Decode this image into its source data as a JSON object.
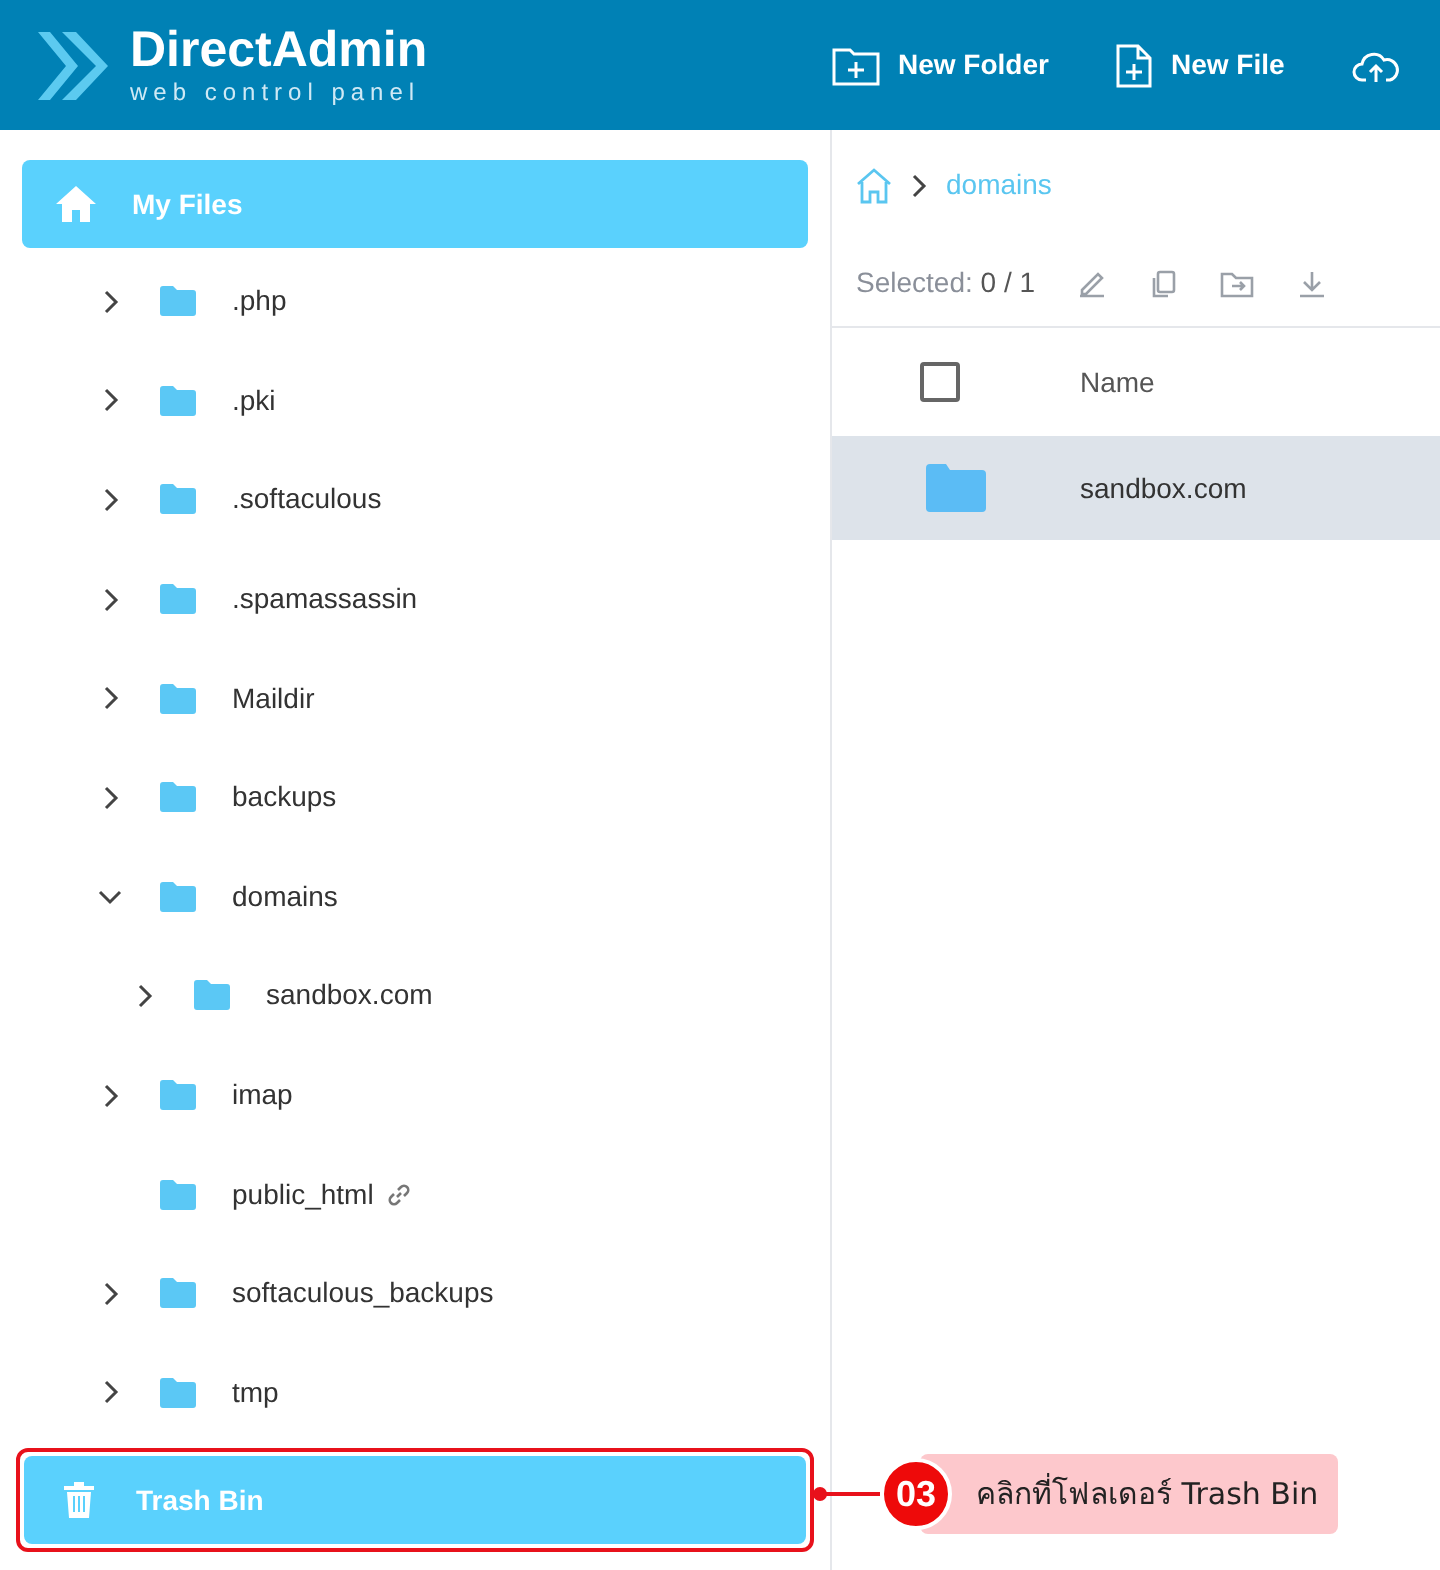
{
  "header": {
    "logo_title": "DirectAdmin",
    "logo_subtitle": "web control panel",
    "actions": [
      {
        "kind": "folder",
        "label": "New Folder"
      },
      {
        "kind": "file",
        "label": "New File"
      },
      {
        "kind": "upload"
      }
    ]
  },
  "sidebar": {
    "home": {
      "label": "My Files",
      "selected": true
    },
    "tree": [
      {
        "name": ".php",
        "expandable": true,
        "expanded": false,
        "linked": false
      },
      {
        "name": ".pki",
        "expandable": true,
        "expanded": false,
        "linked": false
      },
      {
        "name": ".softaculous",
        "expandable": true,
        "expanded": false,
        "linked": false
      },
      {
        "name": ".spamassassin",
        "expandable": true,
        "expanded": false,
        "linked": false
      },
      {
        "name": "Maildir",
        "expandable": true,
        "expanded": false,
        "linked": false
      },
      {
        "name": "backups",
        "expandable": true,
        "expanded": false,
        "linked": false
      },
      {
        "name": "domains",
        "expandable": true,
        "expanded": true,
        "linked": false,
        "children": [
          {
            "name": "sandbox.com",
            "expandable": true,
            "expanded": false
          }
        ]
      },
      {
        "name": "imap",
        "expandable": true,
        "expanded": false,
        "linked": false
      },
      {
        "name": "public_html",
        "expandable": false,
        "expanded": false,
        "linked": true
      },
      {
        "name": "softaculous_backups",
        "expandable": true,
        "expanded": false,
        "linked": false
      },
      {
        "name": "tmp",
        "expandable": true,
        "expanded": false,
        "linked": false
      }
    ],
    "trash": {
      "label": "Trash Bin",
      "selected": true,
      "highlighted": true
    }
  },
  "breadcrumb": [
    "domains"
  ],
  "selection": {
    "label": "Selected:",
    "count": "0 / 1"
  },
  "table": {
    "columns": [
      "Name"
    ],
    "all_checked": false,
    "rows": [
      {
        "name": "sandbox.com",
        "selected": true
      }
    ]
  },
  "callout": {
    "number": "03",
    "text": "คลิกที่โฟลเดอร์ Trash Bin"
  }
}
